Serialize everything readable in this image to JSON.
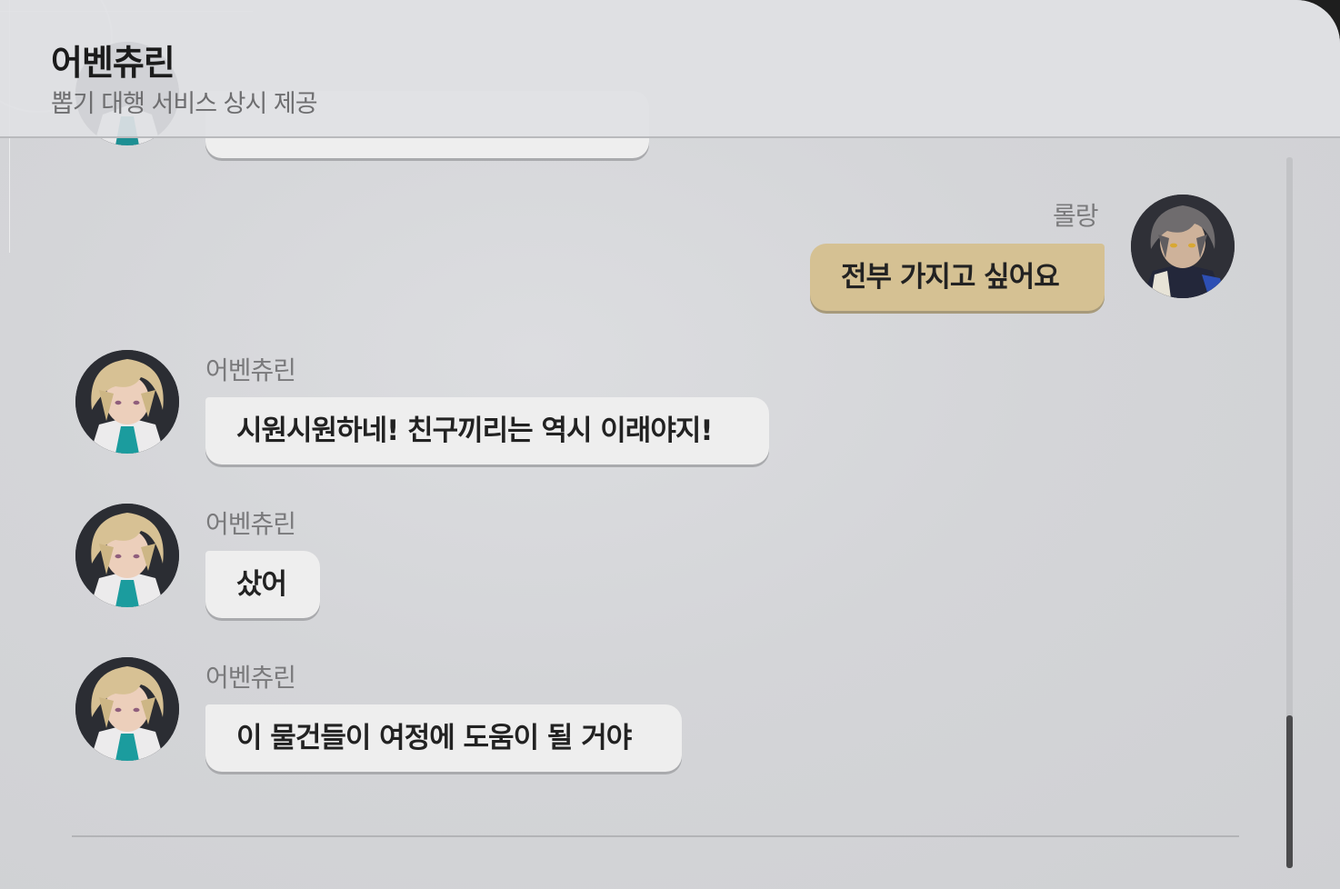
{
  "header": {
    "title": "어벤츄린",
    "subtitle": "뽑기 대행 서비스 상시 제공"
  },
  "messages": [
    {
      "sender": "롤랑",
      "text": "전부 가지고 싶어요",
      "side": "right"
    },
    {
      "sender": "어벤츄린",
      "text": "시원시원하네! 친구끼리는 역시 이래야지!",
      "side": "left"
    },
    {
      "sender": "어벤츄린",
      "text": "샀어",
      "side": "left"
    },
    {
      "sender": "어벤츄린",
      "text": "이 물건들이 여정에 도움이 될 거야",
      "side": "left"
    }
  ],
  "colors": {
    "panel_background": "#d6d7da",
    "bubble_incoming": "#eeeeee",
    "bubble_outgoing": "#d5c193",
    "scrollbar_thumb": "#4b4b4d"
  },
  "scroll": {
    "position_fraction": 0.79
  }
}
